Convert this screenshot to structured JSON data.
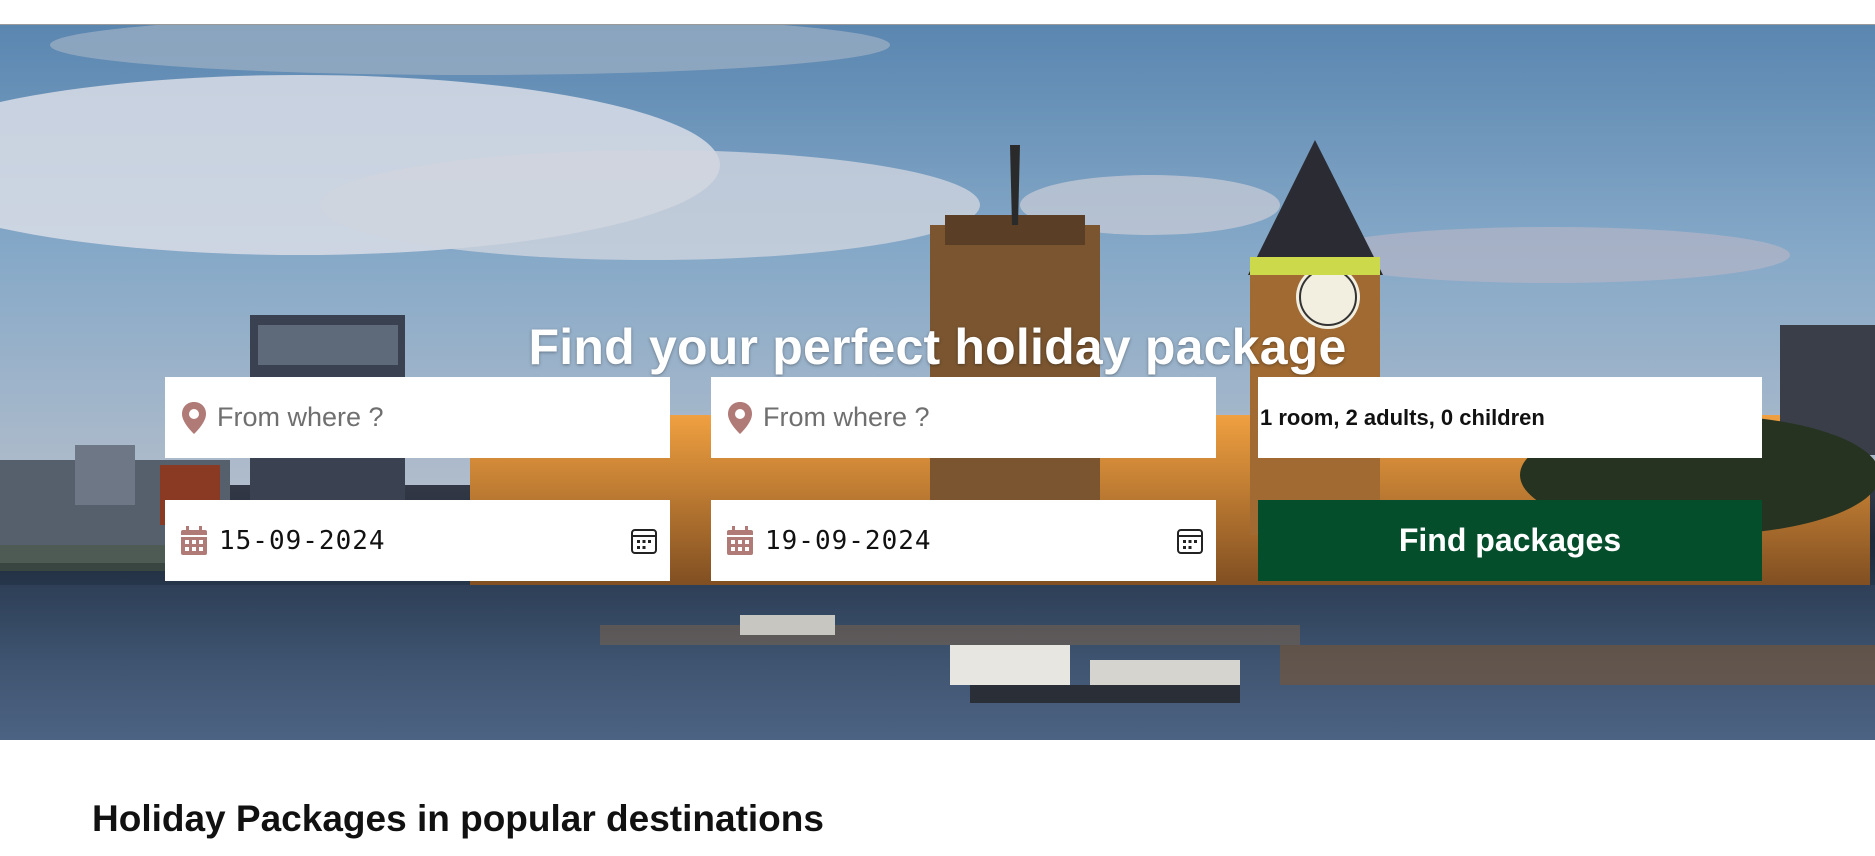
{
  "hero": {
    "title": "Find your perfect holiday package"
  },
  "search": {
    "origin": {
      "placeholder": "From where ?",
      "icon": "map-pin-icon"
    },
    "destination": {
      "placeholder": "From where ?",
      "icon": "map-pin-icon"
    },
    "guests": {
      "value": "1 room, 2 adults, 0 children"
    },
    "start_date": {
      "value": "15-09-2024",
      "icon": "calendar-icon"
    },
    "end_date": {
      "value": "19-09-2024",
      "icon": "calendar-icon"
    },
    "submit_label": "Find packages"
  },
  "popular": {
    "title": "Holiday Packages in popular destinations"
  },
  "colors": {
    "button": "#054e2c",
    "icon": "#b07a77",
    "field_bg": "#ffffff"
  }
}
